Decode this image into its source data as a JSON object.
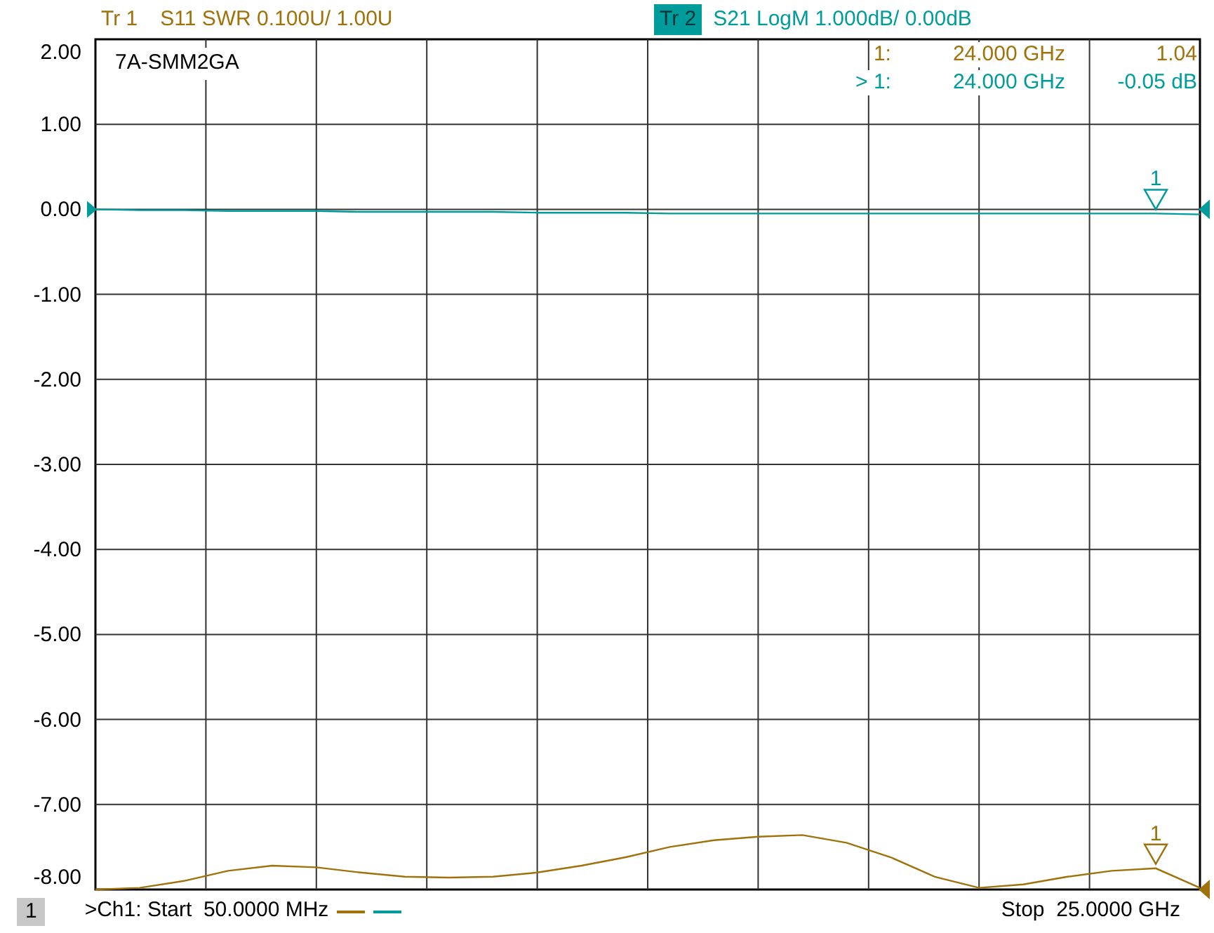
{
  "header": {
    "traces": [
      {
        "label": "Tr 1",
        "text": "S11 SWR 0.100U/ 1.00U",
        "color": "#a0720c",
        "selected": false
      },
      {
        "label": "Tr 2",
        "text": "S21 LogM 1.000dB/ 0.00dB",
        "color": "#009c9c",
        "selected": true
      }
    ]
  },
  "plot": {
    "title": "7A-SMM2GA",
    "marker_readouts": [
      {
        "name": "1:",
        "frequency": "24.000 GHz",
        "value": "1.04",
        "color": "#a0720c"
      },
      {
        "name": "> 1:",
        "frequency": "24.000 GHz",
        "value": "-0.05 dB",
        "color": "#009c9c"
      }
    ],
    "markers": [
      {
        "label": "1"
      },
      {
        "label": "1"
      }
    ],
    "chart_data": {
      "type": "line",
      "grid": true,
      "ylim": [
        -8,
        2
      ],
      "yticks": [
        {
          "value": 2,
          "label": "2.00"
        },
        {
          "value": 1,
          "label": "1.00"
        },
        {
          "value": 0,
          "label": "0.00"
        },
        {
          "value": -1,
          "label": "-1.00"
        },
        {
          "value": -2,
          "label": "-2.00"
        },
        {
          "value": -3,
          "label": "-3.00"
        },
        {
          "value": -4,
          "label": "-4.00"
        },
        {
          "value": -5,
          "label": "-5.00"
        },
        {
          "value": -6,
          "label": "-6.00"
        },
        {
          "value": -7,
          "label": "-7.00"
        },
        {
          "value": -8,
          "label": "-8.00"
        }
      ],
      "categories": [
        null,
        null,
        null,
        null,
        null,
        null,
        null,
        null,
        null,
        null,
        null,
        null,
        null,
        null,
        null,
        null,
        null,
        null,
        null,
        null,
        null,
        null,
        null,
        null,
        null,
        null
      ],
      "series": [
        {
          "color": "#a0720c",
          "values": [
            -8,
            -7.98,
            -7.9,
            -7.78,
            -7.72,
            -7.74,
            -7.8,
            -7.85,
            -7.86,
            -7.85,
            -7.8,
            -7.72,
            -7.62,
            -7.5,
            -7.42,
            -7.38,
            -7.36,
            -7.45,
            -7.62,
            -7.85,
            -7.98,
            -7.94,
            -7.85,
            -7.78,
            -7.75,
            -7.98
          ]
        },
        {
          "color": "#009c9c",
          "values": [
            0,
            -0.01,
            -0.01,
            -0.02,
            -0.02,
            -0.02,
            -0.03,
            -0.03,
            -0.03,
            -0.03,
            -0.04,
            -0.04,
            -0.04,
            -0.05,
            -0.05,
            -0.05,
            -0.05,
            -0.05,
            -0.05,
            -0.05,
            -0.05,
            -0.05,
            -0.05,
            -0.05,
            -0.05,
            -0.06
          ]
        }
      ]
    }
  },
  "footer": {
    "channel": "1",
    "start": ">Ch1: Start  50.0000 MHz",
    "stop": "Stop  25.0000 GHz"
  }
}
